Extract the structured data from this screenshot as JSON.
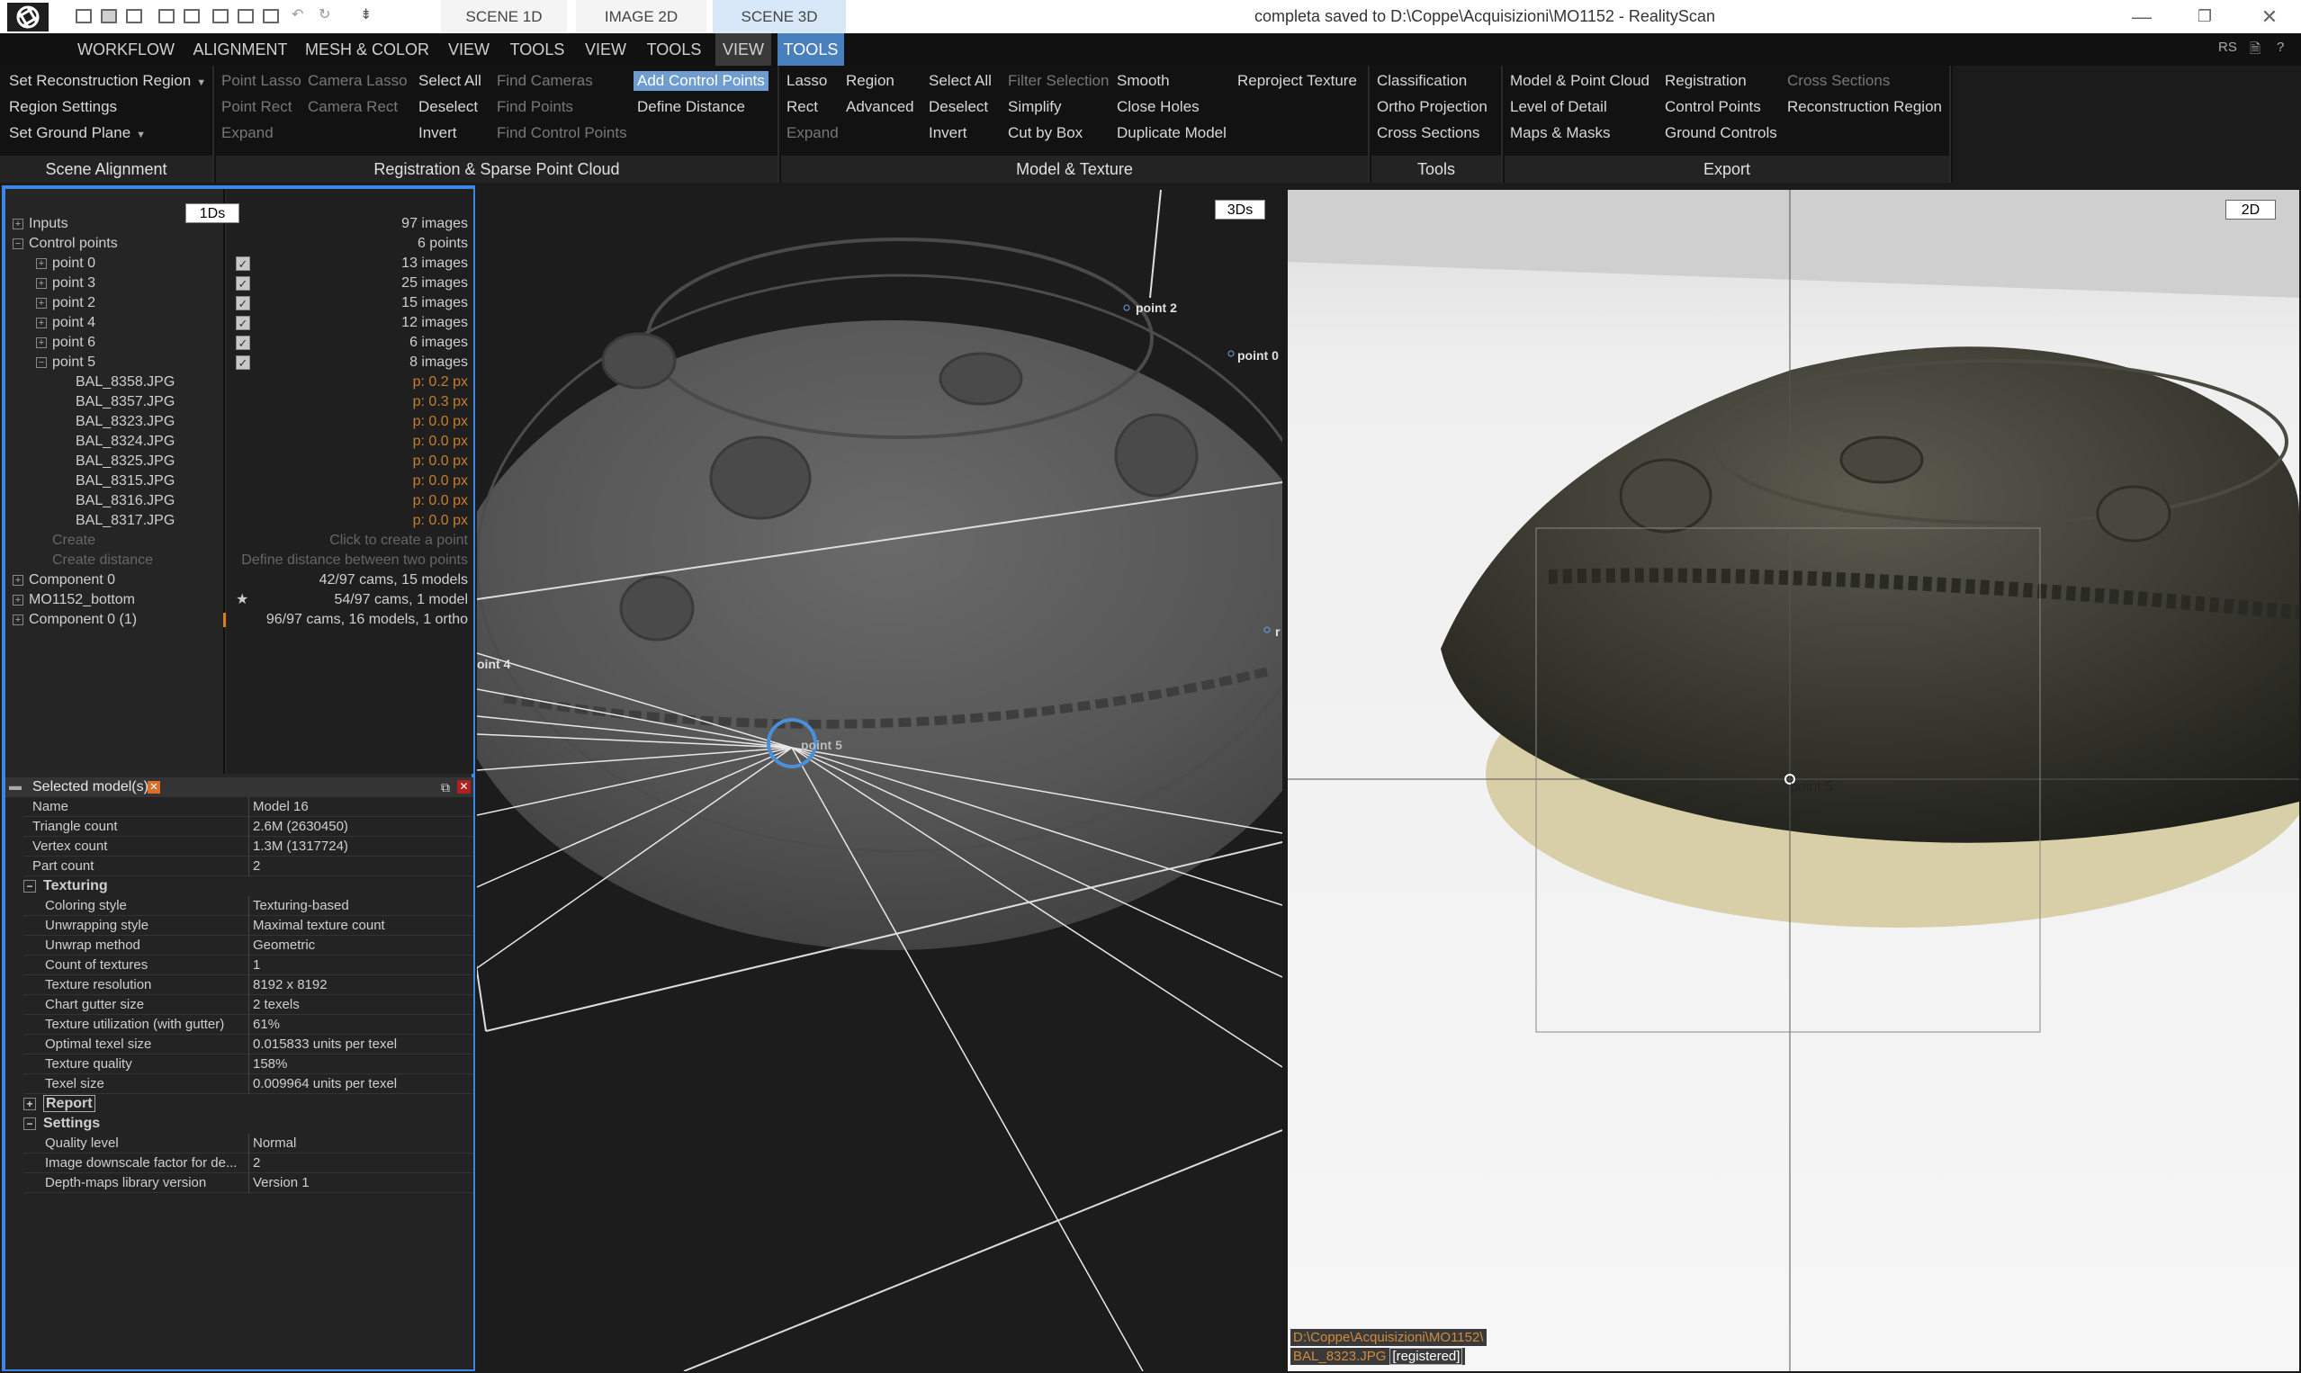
{
  "window": {
    "title": "completa saved to D:\\Coppe\\Acquisizioni\\MO1152 - RealityScan",
    "doc_tabs": [
      "SCENE 1D",
      "IMAGE 2D",
      "SCENE 3D"
    ],
    "controls": [
      "—",
      "❐",
      "✕"
    ]
  },
  "menu": {
    "items": [
      "WORKFLOW",
      "ALIGNMENT",
      "MESH & COLOR",
      "VIEW",
      "TOOLS",
      "VIEW",
      "TOOLS",
      "VIEW",
      "TOOLS"
    ],
    "right": [
      "RS",
      "🗎",
      "?"
    ]
  },
  "ribbon": {
    "scene_alignment": {
      "label": "Scene Alignment",
      "set_region": "Set Reconstruction Region",
      "region_settings": "Region Settings",
      "ground_plane": "Set Ground Plane"
    },
    "registration": {
      "label": "Registration & Sparse Point Cloud",
      "point_lasso": "Point Lasso",
      "point_rect": "Point Rect",
      "expand": "Expand",
      "camera_lasso": "Camera Lasso",
      "camera_rect": "Camera Rect",
      "select_all": "Select All",
      "deselect": "Deselect",
      "invert": "Invert",
      "find_cameras": "Find Cameras",
      "find_points": "Find Points",
      "find_control_points": "Find Control Points",
      "add_control_points": "Add Control Points",
      "define_distance": "Define Distance"
    },
    "model_texture": {
      "label": "Model & Texture",
      "lasso": "Lasso",
      "rect": "Rect",
      "expand": "Expand",
      "region": "Region",
      "advanced": "Advanced",
      "select_all": "Select All",
      "deselect": "Deselect",
      "invert": "Invert",
      "filter_selection": "Filter Selection",
      "simplify": "Simplify",
      "cut_by_box": "Cut by Box",
      "smooth": "Smooth",
      "close_holes": "Close Holes",
      "duplicate_model": "Duplicate Model",
      "reproject_texture": "Reproject Texture"
    },
    "tools": {
      "label": "Tools",
      "classification": "Classification",
      "ortho_projection": "Ortho Projection",
      "cross_sections": "Cross Sections"
    },
    "export": {
      "label": "Export",
      "model_point_cloud": "Model & Point Cloud",
      "level_of_detail": "Level of Detail",
      "maps_masks": "Maps & Masks",
      "registration": "Registration",
      "control_points": "Control Points",
      "ground_controls": "Ground Controls",
      "cross_sections": "Cross Sections",
      "reconstruction_region": "Reconstruction Region"
    }
  },
  "tree": {
    "badge": "1Ds",
    "rows": [
      {
        "name": "Inputs",
        "value": "97 images"
      },
      {
        "name": "Control points",
        "value": "6 points"
      },
      {
        "name": "point 0",
        "value": "13 images"
      },
      {
        "name": "point 3",
        "value": "25 images"
      },
      {
        "name": "point 2",
        "value": "15 images"
      },
      {
        "name": "point 4",
        "value": "12 images"
      },
      {
        "name": "point 6",
        "value": "6 images"
      },
      {
        "name": "point 5",
        "value": "8 images"
      },
      {
        "name": "BAL_8358.JPG",
        "value": "p: 0.2 px"
      },
      {
        "name": "BAL_8357.JPG",
        "value": "p: 0.3 px"
      },
      {
        "name": "BAL_8323.JPG",
        "value": "p: 0.0 px"
      },
      {
        "name": "BAL_8324.JPG",
        "value": "p: 0.0 px"
      },
      {
        "name": "BAL_8325.JPG",
        "value": "p: 0.0 px"
      },
      {
        "name": "BAL_8315.JPG",
        "value": "p: 0.0 px"
      },
      {
        "name": "BAL_8316.JPG",
        "value": "p: 0.0 px"
      },
      {
        "name": "BAL_8317.JPG",
        "value": "p: 0.0 px"
      },
      {
        "name": "Create",
        "value": "Click to create a point"
      },
      {
        "name": "Create distance",
        "value": "Define distance between two points"
      },
      {
        "name": "Component 0",
        "value": "42/97 cams, 15 models"
      },
      {
        "name": "MO1152_bottom",
        "value": "54/97 cams, 1 model"
      },
      {
        "name": "Component 0 (1)",
        "value": "96/97 cams, 16 models, 1 ortho"
      }
    ]
  },
  "props": {
    "header": "Selected model(s)",
    "rows": [
      {
        "name": "Name",
        "value": "Model 16"
      },
      {
        "name": "Triangle count",
        "value": "2.6M (2630450)"
      },
      {
        "name": "Vertex count",
        "value": "1.3M (1317724)"
      },
      {
        "name": "Part count",
        "value": "2"
      }
    ],
    "texturing_label": "Texturing",
    "texturing": [
      {
        "name": "Coloring style",
        "value": "Texturing-based"
      },
      {
        "name": "Unwrapping style",
        "value": "Maximal texture count"
      },
      {
        "name": "Unwrap method",
        "value": "Geometric"
      },
      {
        "name": "Count of textures",
        "value": "1"
      },
      {
        "name": "Texture resolution",
        "value": "8192 x 8192"
      },
      {
        "name": "Chart gutter size",
        "value": "2 texels"
      },
      {
        "name": "Texture utilization (with gutter)",
        "value": "61%"
      },
      {
        "name": "Optimal texel size",
        "value": "0.015833 units per texel"
      },
      {
        "name": "Texture quality",
        "value": "158%"
      },
      {
        "name": "Texel size",
        "value": "0.009964 units per texel"
      }
    ],
    "report_label": "Report",
    "settings_label": "Settings",
    "settings": [
      {
        "name": "Quality level",
        "value": "Normal"
      },
      {
        "name": "Image downscale factor for de...",
        "value": "2"
      },
      {
        "name": "Depth-maps library version",
        "value": "Version 1"
      }
    ]
  },
  "view3d": {
    "badge": "3Ds",
    "labels": {
      "point2": "point 2",
      "point0": "point 0",
      "point4": "oint 4",
      "point5": "point 5",
      "edge_r": "r"
    }
  },
  "view2d": {
    "badge": "2D",
    "point_label": "point 5",
    "path": "D:\\Coppe\\Acquisizioni\\MO1152\\",
    "image_name": "BAL_8323.JPG",
    "image_status": "[registered]"
  }
}
